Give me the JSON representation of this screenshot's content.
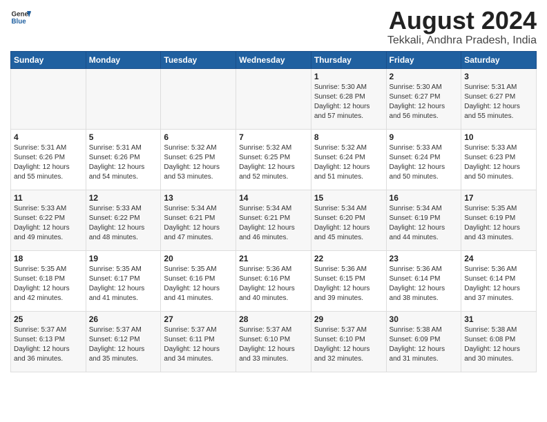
{
  "header": {
    "logo_general": "General",
    "logo_blue": "Blue",
    "month_year": "August 2024",
    "location": "Tekkali, Andhra Pradesh, India"
  },
  "weekdays": [
    "Sunday",
    "Monday",
    "Tuesday",
    "Wednesday",
    "Thursday",
    "Friday",
    "Saturday"
  ],
  "weeks": [
    [
      {
        "day": "",
        "info": ""
      },
      {
        "day": "",
        "info": ""
      },
      {
        "day": "",
        "info": ""
      },
      {
        "day": "",
        "info": ""
      },
      {
        "day": "1",
        "info": "Sunrise: 5:30 AM\nSunset: 6:28 PM\nDaylight: 12 hours\nand 57 minutes."
      },
      {
        "day": "2",
        "info": "Sunrise: 5:30 AM\nSunset: 6:27 PM\nDaylight: 12 hours\nand 56 minutes."
      },
      {
        "day": "3",
        "info": "Sunrise: 5:31 AM\nSunset: 6:27 PM\nDaylight: 12 hours\nand 55 minutes."
      }
    ],
    [
      {
        "day": "4",
        "info": "Sunrise: 5:31 AM\nSunset: 6:26 PM\nDaylight: 12 hours\nand 55 minutes."
      },
      {
        "day": "5",
        "info": "Sunrise: 5:31 AM\nSunset: 6:26 PM\nDaylight: 12 hours\nand 54 minutes."
      },
      {
        "day": "6",
        "info": "Sunrise: 5:32 AM\nSunset: 6:25 PM\nDaylight: 12 hours\nand 53 minutes."
      },
      {
        "day": "7",
        "info": "Sunrise: 5:32 AM\nSunset: 6:25 PM\nDaylight: 12 hours\nand 52 minutes."
      },
      {
        "day": "8",
        "info": "Sunrise: 5:32 AM\nSunset: 6:24 PM\nDaylight: 12 hours\nand 51 minutes."
      },
      {
        "day": "9",
        "info": "Sunrise: 5:33 AM\nSunset: 6:24 PM\nDaylight: 12 hours\nand 50 minutes."
      },
      {
        "day": "10",
        "info": "Sunrise: 5:33 AM\nSunset: 6:23 PM\nDaylight: 12 hours\nand 50 minutes."
      }
    ],
    [
      {
        "day": "11",
        "info": "Sunrise: 5:33 AM\nSunset: 6:22 PM\nDaylight: 12 hours\nand 49 minutes."
      },
      {
        "day": "12",
        "info": "Sunrise: 5:33 AM\nSunset: 6:22 PM\nDaylight: 12 hours\nand 48 minutes."
      },
      {
        "day": "13",
        "info": "Sunrise: 5:34 AM\nSunset: 6:21 PM\nDaylight: 12 hours\nand 47 minutes."
      },
      {
        "day": "14",
        "info": "Sunrise: 5:34 AM\nSunset: 6:21 PM\nDaylight: 12 hours\nand 46 minutes."
      },
      {
        "day": "15",
        "info": "Sunrise: 5:34 AM\nSunset: 6:20 PM\nDaylight: 12 hours\nand 45 minutes."
      },
      {
        "day": "16",
        "info": "Sunrise: 5:34 AM\nSunset: 6:19 PM\nDaylight: 12 hours\nand 44 minutes."
      },
      {
        "day": "17",
        "info": "Sunrise: 5:35 AM\nSunset: 6:19 PM\nDaylight: 12 hours\nand 43 minutes."
      }
    ],
    [
      {
        "day": "18",
        "info": "Sunrise: 5:35 AM\nSunset: 6:18 PM\nDaylight: 12 hours\nand 42 minutes."
      },
      {
        "day": "19",
        "info": "Sunrise: 5:35 AM\nSunset: 6:17 PM\nDaylight: 12 hours\nand 41 minutes."
      },
      {
        "day": "20",
        "info": "Sunrise: 5:35 AM\nSunset: 6:16 PM\nDaylight: 12 hours\nand 41 minutes."
      },
      {
        "day": "21",
        "info": "Sunrise: 5:36 AM\nSunset: 6:16 PM\nDaylight: 12 hours\nand 40 minutes."
      },
      {
        "day": "22",
        "info": "Sunrise: 5:36 AM\nSunset: 6:15 PM\nDaylight: 12 hours\nand 39 minutes."
      },
      {
        "day": "23",
        "info": "Sunrise: 5:36 AM\nSunset: 6:14 PM\nDaylight: 12 hours\nand 38 minutes."
      },
      {
        "day": "24",
        "info": "Sunrise: 5:36 AM\nSunset: 6:14 PM\nDaylight: 12 hours\nand 37 minutes."
      }
    ],
    [
      {
        "day": "25",
        "info": "Sunrise: 5:37 AM\nSunset: 6:13 PM\nDaylight: 12 hours\nand 36 minutes."
      },
      {
        "day": "26",
        "info": "Sunrise: 5:37 AM\nSunset: 6:12 PM\nDaylight: 12 hours\nand 35 minutes."
      },
      {
        "day": "27",
        "info": "Sunrise: 5:37 AM\nSunset: 6:11 PM\nDaylight: 12 hours\nand 34 minutes."
      },
      {
        "day": "28",
        "info": "Sunrise: 5:37 AM\nSunset: 6:10 PM\nDaylight: 12 hours\nand 33 minutes."
      },
      {
        "day": "29",
        "info": "Sunrise: 5:37 AM\nSunset: 6:10 PM\nDaylight: 12 hours\nand 32 minutes."
      },
      {
        "day": "30",
        "info": "Sunrise: 5:38 AM\nSunset: 6:09 PM\nDaylight: 12 hours\nand 31 minutes."
      },
      {
        "day": "31",
        "info": "Sunrise: 5:38 AM\nSunset: 6:08 PM\nDaylight: 12 hours\nand 30 minutes."
      }
    ]
  ]
}
